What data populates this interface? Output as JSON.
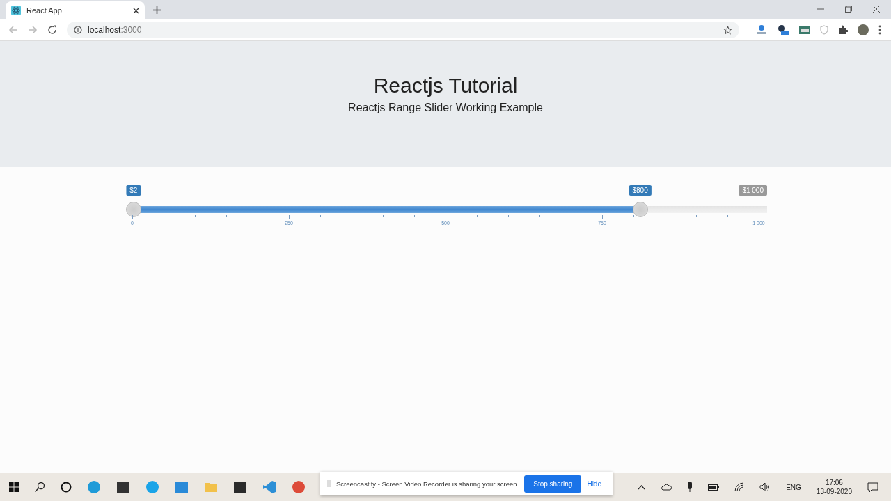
{
  "browser": {
    "tab_title": "React App",
    "url_host": "localhost",
    "url_port": ":3000"
  },
  "header": {
    "title": "Reactjs Tutorial",
    "subtitle": "Reactjs Range Slider Working Example"
  },
  "slider": {
    "handles": [
      {
        "label": "$2",
        "level": 0.002
      },
      {
        "label": "$800",
        "level": 0.8
      }
    ],
    "max_label": "$1 000",
    "tick_labels": [
      "0",
      "250",
      "500",
      "750",
      "1 000"
    ]
  },
  "notification": {
    "message": "Screencastify - Screen Video Recorder is sharing your screen.",
    "buttons": [
      "Stop sharing",
      "Hide"
    ]
  },
  "taskbar": {
    "apps": [
      {
        "kind": "edge"
      },
      {
        "kind": "store"
      },
      {
        "kind": "skype"
      },
      {
        "kind": "mail"
      },
      {
        "kind": "folder"
      },
      {
        "kind": "notes"
      },
      {
        "kind": "code"
      },
      {
        "kind": "chrome"
      }
    ],
    "language": "ENG",
    "time": "17:06",
    "date": "13-09-2020"
  }
}
